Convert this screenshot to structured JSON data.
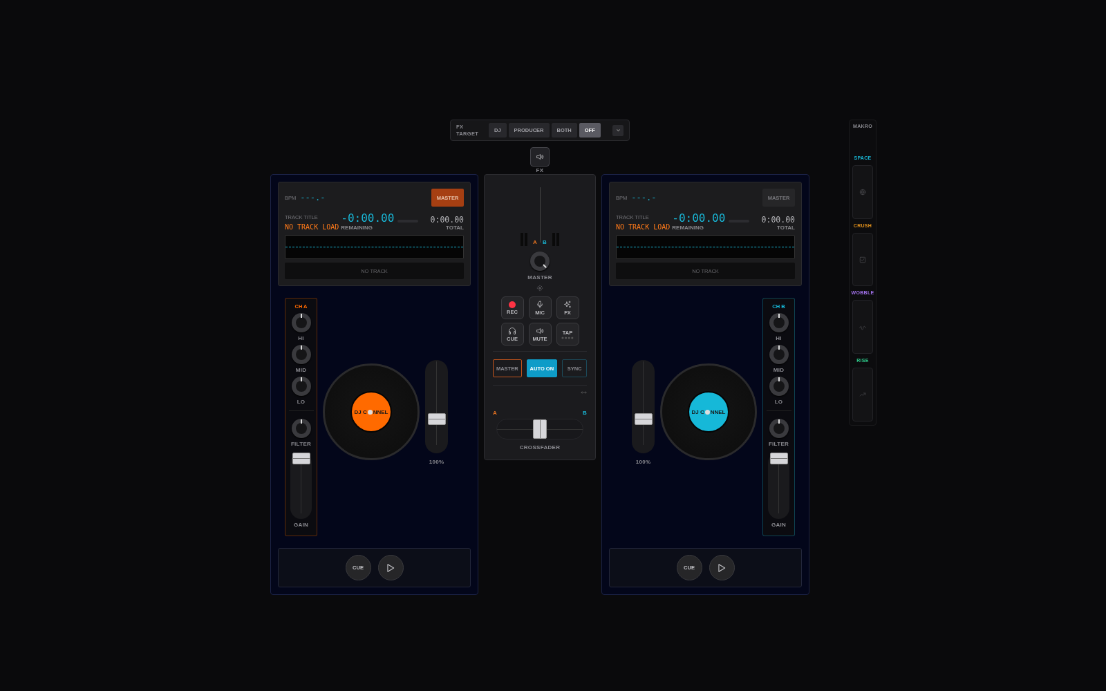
{
  "fx_target": {
    "label": "FX TARGET",
    "options": [
      {
        "label": "DJ",
        "selected": false
      },
      {
        "label": "PRODUCER",
        "selected": false
      },
      {
        "label": "BOTH",
        "selected": false
      },
      {
        "label": "OFF",
        "selected": true
      }
    ],
    "speaker_label": "FX"
  },
  "decks": [
    {
      "mirrored": false,
      "color": "#ff6a00",
      "bpm_label": "BPM",
      "bpm": "---.-",
      "master": {
        "label": "MASTER",
        "selected": true
      },
      "track_title_label": "TRACK TITLE",
      "track_title": "NO TRACK LOAD",
      "remaining": "-0:00.00",
      "remaining_label": "REMAINING",
      "total": "0:00.00",
      "total_label": "TOTAL",
      "no_track": "NO TRACK",
      "channel": {
        "label": "CH A",
        "eq": [
          {
            "label": "HI"
          },
          {
            "label": "MID"
          },
          {
            "label": "LO"
          }
        ],
        "filter": {
          "label": "FILTER"
        },
        "gain": {
          "label": "GAIN",
          "level": 1
        }
      },
      "platter_label": [
        "DJ C",
        "NNEL"
      ],
      "pitch": {
        "level": 0.35,
        "reading": "100%"
      },
      "transport": {
        "cue": "CUE"
      }
    },
    {
      "mirrored": true,
      "color": "#16b8d8",
      "bpm_label": "BPM",
      "bpm": "---.-",
      "master": {
        "label": "MASTER",
        "selected": false
      },
      "track_title_label": "TRACK TITLE",
      "track_title": "NO TRACK LOAD",
      "remaining": "-0:00.00",
      "remaining_label": "REMAINING",
      "total": "0:00.00",
      "total_label": "TOTAL",
      "no_track": "NO TRACK",
      "channel": {
        "label": "CH B",
        "eq": [
          {
            "label": "HI"
          },
          {
            "label": "MID"
          },
          {
            "label": "LO"
          }
        ],
        "filter": {
          "label": "FILTER"
        },
        "gain": {
          "label": "GAIN",
          "level": 1
        }
      },
      "platter_label": [
        "DJ C",
        "NNEL"
      ],
      "pitch": {
        "level": 0.35,
        "reading": "100%"
      },
      "transport": {
        "cue": "CUE"
      }
    }
  ],
  "mixer": {
    "meter_a": "A",
    "meter_b": "B",
    "master_knob": {
      "label": "MASTER"
    },
    "pads": [
      {
        "kind": "rec",
        "label": "REC"
      },
      {
        "kind": "mic",
        "label": "MIC"
      },
      {
        "kind": "fx",
        "label": "FX"
      },
      {
        "kind": "cue",
        "label": "CUE"
      },
      {
        "kind": "mute",
        "label": "MUTE"
      },
      {
        "kind": "tap",
        "label": "TAP"
      }
    ],
    "modes": [
      {
        "label": "MASTER",
        "selected": false,
        "color": "#c2541c"
      },
      {
        "label": "AUTO ON",
        "selected": true,
        "color": "#0e9cc8"
      },
      {
        "label": "SYNC",
        "selected": false,
        "color": "#1c4a5a"
      }
    ],
    "crossfader": {
      "label_a": "A",
      "label_b": "B",
      "level": 0.5,
      "label": "CROSSFADER"
    }
  },
  "macro": {
    "title": "MAKRO",
    "items": [
      {
        "kind": "space",
        "label": "SPACE",
        "color": "#19b3d0"
      },
      {
        "kind": "crush",
        "label": "CRUSH",
        "color": "#e0901c"
      },
      {
        "kind": "wobble",
        "label": "WOBBLE",
        "color": "#a070e8"
      },
      {
        "kind": "rise",
        "label": "RISE",
        "color": "#2ec98a"
      }
    ]
  }
}
